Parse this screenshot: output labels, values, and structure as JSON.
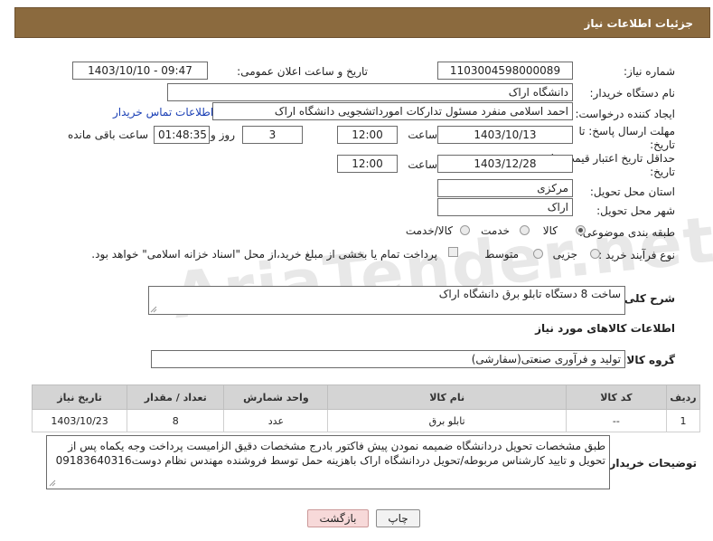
{
  "header": {
    "title": "جزئیات اطلاعات نیاز"
  },
  "form": {
    "need_number_label": "شماره نیاز:",
    "need_number": "1103004598000089",
    "announce_label": "تاریخ و ساعت اعلان عمومی:",
    "announce_value": "1403/10/10 - 09:47",
    "buyer_org_label": "نام دستگاه خریدار:",
    "buyer_org": "دانشگاه اراک",
    "creator_label": "ایجاد کننده درخواست:",
    "creator": "احمد  اسلامی منفرد مسئول تدارکات امورداتشجویی دانشگاه اراک",
    "contact_link": "اطلاعات تماس خریدار",
    "deadline_label": "مهلت ارسال پاسخ: تا",
    "deadline_label2": "تاریخ:",
    "deadline_date": "1403/10/13",
    "time_label": "ساعت",
    "deadline_time": "12:00",
    "days_value": "3",
    "days_label": "روز و",
    "remaining_time": "01:48:35",
    "remaining_label": "ساعت باقی مانده",
    "validity_label": "حداقل تاریخ اعتبار قیمت: تا",
    "validity_label2": "تاریخ:",
    "validity_date": "1403/12/28",
    "validity_time": "12:00",
    "province_label": "استان محل تحویل:",
    "province": "مرکزی",
    "city_label": "شهر محل تحویل:",
    "city": "اراک",
    "category_label": "طبقه بندی موضوعی:",
    "category_options": [
      "کالا",
      "خدمت",
      "کالا/خدمت"
    ],
    "process_label": "نوع فرآیند خرید :",
    "process_options": [
      "جزیی",
      "متوسط"
    ],
    "payment_text": "پرداخت تمام یا بخشی از مبلغ خرید،از محل \"اسناد خزانه اسلامی\" خواهد بود.",
    "description_label": "شرح کلی نیاز:",
    "description": "ساخت 8 دستگاه تابلو برق دانشگاه اراک",
    "goods_section_title": "اطلاعات کالاهای مورد نیاز",
    "goods_group_label": "گروه کالا:",
    "goods_group": "تولید و فرآوری صنعتی(سفارشی)"
  },
  "table": {
    "headers": [
      "ردیف",
      "کد کالا",
      "نام کالا",
      "واحد شمارش",
      "تعداد / مقدار",
      "تاریخ نیاز"
    ],
    "rows": [
      [
        "1",
        "--",
        "تابلو برق",
        "عدد",
        "8",
        "1403/10/23"
      ]
    ]
  },
  "buyer_notes_label": "توضیحات خریدار:",
  "buyer_notes": "طبق مشخصات تحویل دردانشگاه ضمیمه نمودن پیش فاکتور بادرج مشخصات دقیق الزامیست پرداخت وجه یکماه پس از تحویل و تایید کارشناس مربوطه/تحویل دردانشگاه اراک باهزینه حمل توسط فروشنده مهندس نظام دوست09183640316",
  "buttons": {
    "print": "چاپ",
    "back": "بازگشت"
  },
  "watermark": "AriaTender.net"
}
